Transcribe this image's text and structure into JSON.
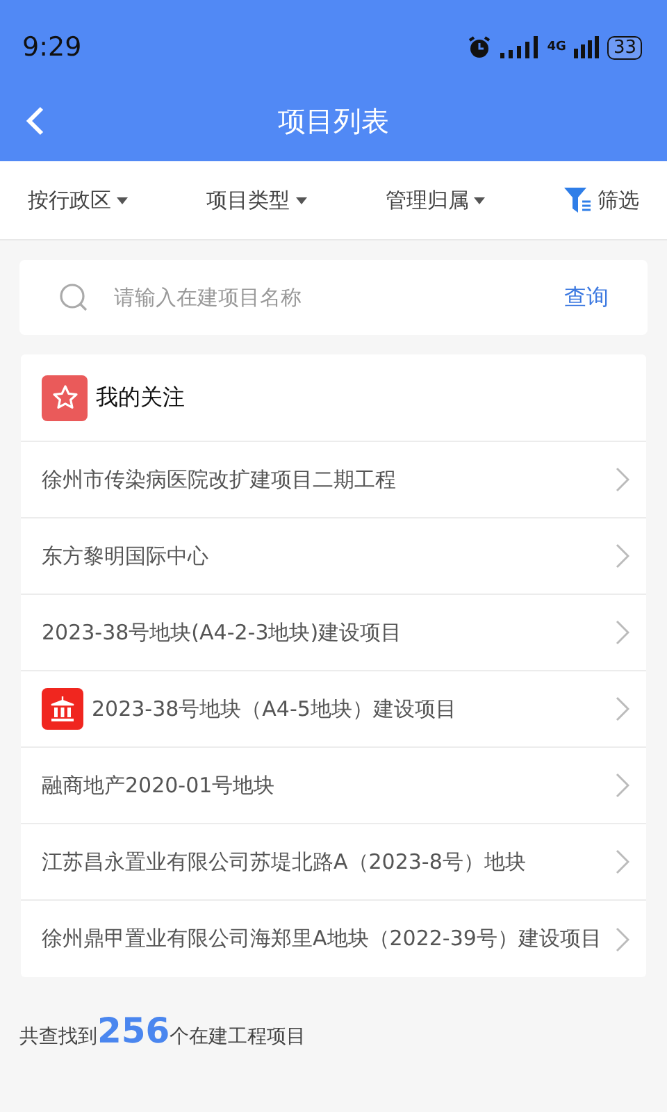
{
  "status_bar": {
    "time": "9:29",
    "network": "4G",
    "battery": "33"
  },
  "header": {
    "title": "项目列表"
  },
  "filters": [
    {
      "label": "按行政区",
      "kind": "dropdown"
    },
    {
      "label": "项目类型",
      "kind": "dropdown"
    },
    {
      "label": "管理归属",
      "kind": "dropdown"
    },
    {
      "label": "筛选",
      "kind": "filter"
    }
  ],
  "search": {
    "placeholder": "请输入在建项目名称",
    "button": "查询"
  },
  "favorites": {
    "title": "我的关注",
    "items": [
      {
        "name": "徐州市传染病医院改扩建项目二期工程",
        "kind": "plain"
      },
      {
        "name": "东方黎明国际中心",
        "kind": "plain"
      },
      {
        "name": "2023-38号地块(A4-2-3地块)建设项目",
        "kind": "plain"
      },
      {
        "name": "2023-38号地块（A4-5地块）建设项目",
        "kind": "flagged"
      },
      {
        "name": "融商地产2020-01号地块",
        "kind": "plain"
      },
      {
        "name": "江苏昌永置业有限公司苏堤北路A（2023-8号）地块",
        "kind": "plain"
      },
      {
        "name": "徐州鼎甲置业有限公司海郑里A地块（2022-39号）建设项目",
        "kind": "plain"
      }
    ]
  },
  "summary": {
    "prefix": "共查找到",
    "count": "256",
    "suffix": "个在建工程项目"
  }
}
